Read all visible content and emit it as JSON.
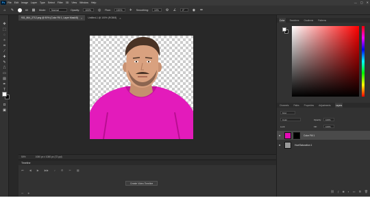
{
  "menu": {
    "logo": "Ps",
    "items": [
      "File",
      "Edit",
      "Image",
      "Layer",
      "Type",
      "Select",
      "Filter",
      "3D",
      "View",
      "Window",
      "Help"
    ]
  },
  "window_controls": [
    "—",
    "▢",
    "✕"
  ],
  "options_bar": {
    "mode_label": "Mode:",
    "mode_value": "Normal",
    "opacity_label": "Opacity:",
    "opacity_value": "100%",
    "flow_label": "Flow:",
    "flow_value": "100%",
    "smoothing_label": "Smoothing:",
    "smoothing_value": "10%",
    "angle_value": "0°",
    "brush_size": "60"
  },
  "document_tabs": [
    {
      "label": "931_864_2712.png @ 50% (Color Fill 1, Layer Mask/8)",
      "active": true
    },
    {
      "label": "Untitled-1 @ 100% (RGB/8)",
      "active": false
    }
  ],
  "status_bar": {
    "zoom": "50%",
    "doc_info": "1080 px x 1080 px (72 ppi)"
  },
  "timeline": {
    "title": "Timeline",
    "create_button": "Create Video Timeline"
  },
  "panels": {
    "color_tabs": [
      "Color",
      "Swatches",
      "Gradients",
      "Patterns"
    ],
    "layers_tabs": [
      "Channels",
      "Paths",
      "Properties",
      "Adjustments",
      "Layers"
    ],
    "filter_kind": "Kind",
    "blend_mode": "Color",
    "opacity_label": "Opacity:",
    "opacity_value": "100%",
    "lock_label": "Lock:",
    "fill_label": "Fill:",
    "fill_value": "100%",
    "layers": [
      {
        "name": "Color Fill 1",
        "thumb": "#e30ab5",
        "selected": true
      },
      {
        "name": "Hue/Saturation 1",
        "thumb": "#999999",
        "selected": false
      }
    ]
  },
  "colors": {
    "app_bg": "#282828",
    "panel_bg": "#323232",
    "hoodie_pink": "#e31bbb"
  }
}
